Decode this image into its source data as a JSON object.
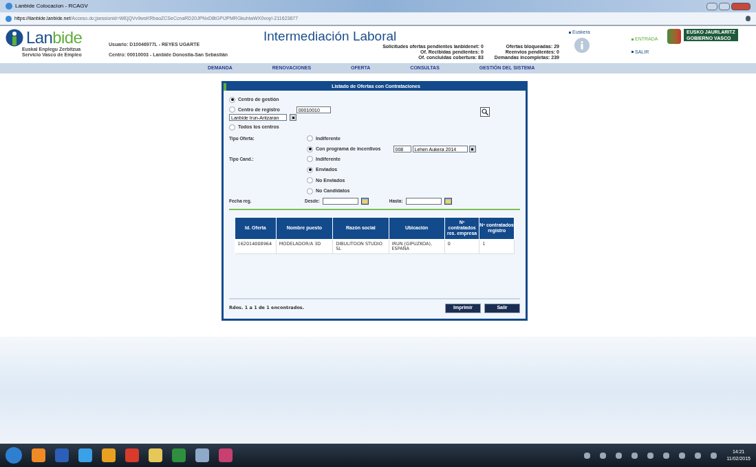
{
  "window": {
    "title": "Lanbide Colocacion - RCAGV"
  },
  "address_bar": {
    "host": "https://ilanbide.lanbide.net",
    "path": "/Acceso.do;jsessionid=WEjQVv9wsKRbaoZCSeCcnaRD20JPNxD8tGPIJPMRGkuhiwWX0voy!-211623677"
  },
  "header": {
    "brand": {
      "first": "Lan",
      "second": "bide"
    },
    "tagline": [
      "Euskal Enplegu Zerbitzua",
      "Servicio Vasco de Empleo"
    ],
    "user": [
      "Usuario: D10046977L - REYES UGARTE",
      "Centro: 00010003 - Lanbide Donostia-San Sebastián"
    ],
    "title": "Intermediación Laboral",
    "stats_left": [
      {
        "label": "Solicitudes ofertas pendientes lanbidenet:",
        "value": "0"
      },
      {
        "label": "Of. Recibidas pendientes:",
        "value": "0"
      },
      {
        "label": "Of. concluidas cobertura:",
        "value": "83"
      }
    ],
    "stats_right": [
      {
        "label": "Ofertas bloqueadas:",
        "value": "29"
      },
      {
        "label": "Reenvios pendientes:",
        "value": "0"
      },
      {
        "label": "Demandas incompletas:",
        "value": "239"
      }
    ],
    "language_link": "Euskera",
    "links": [
      "ENTRADA",
      "SALIR"
    ],
    "gov_logo": [
      "EUSKO JAURLARITZ",
      "GOBIERNO VASCO"
    ]
  },
  "nav": [
    "DEMANDA",
    "RENOVACIONES",
    "OFERTA",
    "CONSULTAS",
    "GESTIÓN DEL SISTEMA"
  ],
  "panel": {
    "title": "Listado de Ofertas con Contrataciones",
    "centro": [
      {
        "label": "Centro de gestión",
        "selected": true
      },
      {
        "label": "Centro de registro",
        "selected": false
      },
      {
        "label": "Todos los centros",
        "selected": false
      }
    ],
    "centro_code": "00010010",
    "centro_select": "Lanbide Irun-Antzaran",
    "tipo_oferta": {
      "label": "Tipo Oferta:",
      "options": [
        {
          "label": "Indiferente",
          "selected": false
        },
        {
          "label": "Con programa de incentivos",
          "selected": true
        }
      ],
      "program_code": "008",
      "program_select": "Lehen Aukera 2014"
    },
    "tipo_cand": {
      "label": "Tipo Cand.:",
      "options": [
        {
          "label": "Indiferente",
          "selected": false
        },
        {
          "label": "Enviados",
          "selected": true
        },
        {
          "label": "No Enviados",
          "selected": false
        },
        {
          "label": "No Candidatos",
          "selected": false
        }
      ]
    },
    "fecha": {
      "label": "Fecha reg.",
      "from": "Desde:",
      "to": "Hasta:"
    },
    "table": {
      "columns": [
        "Id. Oferta",
        "Nombre puesto",
        "Razón social",
        "Ubicación",
        "Nº contratados res. empresa",
        "Nº contratados registro"
      ],
      "rows": [
        [
          "162014008964",
          "MODELADOR/A 3D",
          "DIBULITOON STUDIO SL",
          "IRUN (GIPUZKOA), ESPAÑA",
          "0",
          "1"
        ]
      ]
    },
    "results": "Rdos. 1 a 1 de 1 encontrados.",
    "buttons": [
      "Imprimir",
      "Salir"
    ]
  },
  "taskbar": {
    "time": "14:21",
    "date": "11/02/2015"
  }
}
